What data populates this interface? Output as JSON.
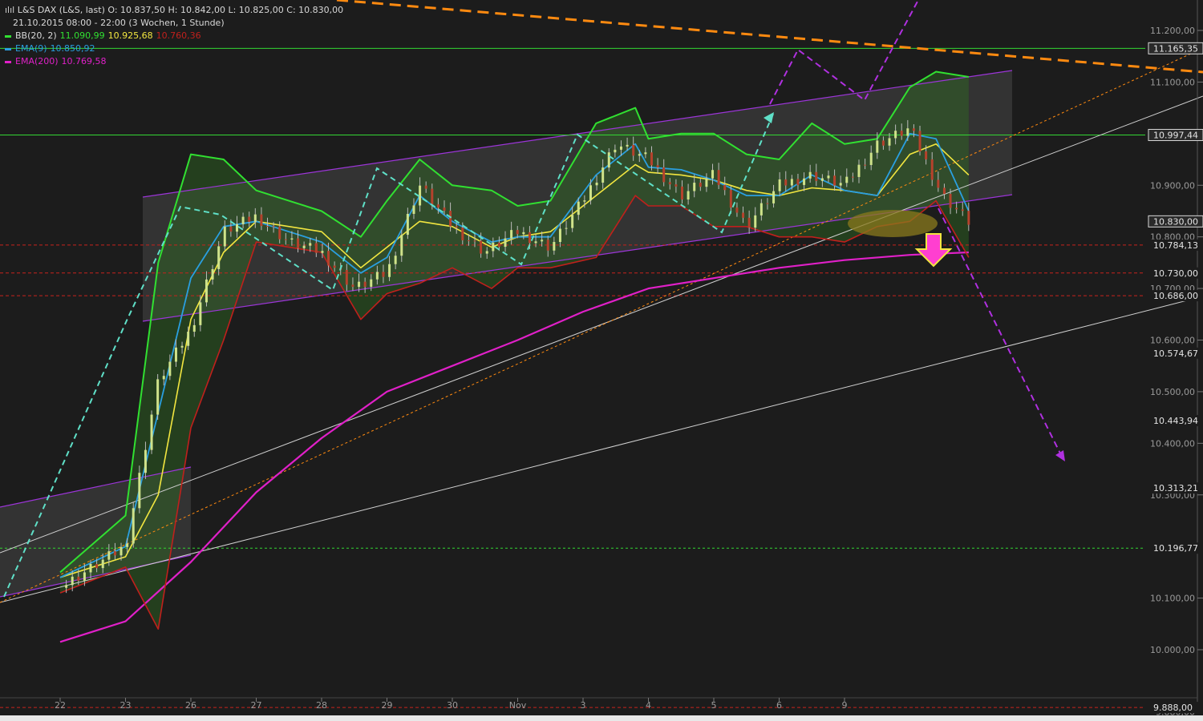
{
  "header": {
    "symbol_line": "L&S DAX (L&S, last)",
    "ohlc": "O: 10.837,50  H: 10.842,00  L: 10.825,00  C: 10.830,00",
    "range_line": "21.10.2015 08:00 - 22:00 (3 Wochen, 1 Stunde)"
  },
  "indicators": [
    {
      "label": "BB(20, 2)",
      "values": [
        "11.090,99",
        "10.925,68",
        "10.760,36"
      ],
      "colors": [
        "#31e031",
        "#f2e640",
        "#c0201c"
      ]
    },
    {
      "label": "EMA(9)",
      "values": [
        "10.850,92"
      ],
      "colors": [
        "#2a9fe0"
      ]
    },
    {
      "label": "EMA(200)",
      "values": [
        "10.769,58"
      ],
      "colors": [
        "#e020c8"
      ]
    }
  ],
  "colors": {
    "background": "#1c1c1c",
    "bb_upper": "#31e031",
    "bb_middle": "#f2e640",
    "bb_lower": "#c0201c",
    "ema9": "#2a9fe0",
    "ema200": "#e020c8",
    "channel": "#9c35d8",
    "resistance_orange": "#ff8a10",
    "arrow_down": "#ff3fd0"
  },
  "chart_data": {
    "type": "line",
    "title": "L&S DAX (L&S, last)",
    "xlabel": "",
    "ylabel": "",
    "ylim": [
      9888,
      11250
    ],
    "grid": false,
    "legend_position": "top-left",
    "y_ticks": [
      "11.200,00",
      "11.100,00",
      "10.997,00",
      "10.900,00",
      "10.800,00",
      "10.700,00",
      "10.600,00",
      "10.500,00",
      "10.400,00",
      "10.300,00",
      "10.100,00",
      "10.000,00",
      "9.880,00"
    ],
    "y_tick_values": [
      11200,
      11100,
      10997,
      10900,
      10800,
      10700,
      10600,
      10500,
      10400,
      10300,
      10100,
      10000,
      9880
    ],
    "x_ticks": [
      "22",
      "23",
      "26",
      "27",
      "28",
      "29",
      "30",
      "Nov",
      "3",
      "4",
      "5",
      "6",
      "9"
    ],
    "price_tags": [
      {
        "label": "11.165,35",
        "value": 11165.35,
        "line": "solid-green"
      },
      {
        "label": "10.997,44",
        "value": 10997.44,
        "line": "solid-green"
      },
      {
        "label": "10.830,00",
        "value": 10830.0,
        "line": "none"
      },
      {
        "label": "10.784,13",
        "value": 10784.13,
        "line": "dashed-red"
      },
      {
        "label": "10.730,00",
        "value": 10730.0,
        "line": "dashed-red"
      },
      {
        "label": "10.686,00",
        "value": 10686.0,
        "line": "dashed-red"
      },
      {
        "label": "10.574,67",
        "value": 10574.67,
        "line": "none"
      },
      {
        "label": "10.443,94",
        "value": 10443.94,
        "line": "none"
      },
      {
        "label": "10.313,21",
        "value": 10313.21,
        "line": "none"
      },
      {
        "label": "10.196,77",
        "value": 10196.77,
        "line": "dashed-green"
      },
      {
        "label": "9.888,00",
        "value": 9888.0,
        "line": "dashed-red"
      }
    ],
    "series": [
      {
        "name": "L&S DAX",
        "x": [
          0,
          1,
          1.5,
          2,
          2.5,
          3,
          3.5,
          4,
          4.5,
          5,
          5.5,
          6,
          6.5,
          7,
          7.5,
          8,
          8.5,
          9,
          9.5,
          10,
          10.5,
          11,
          11.5,
          12,
          12.5,
          13,
          13.5,
          13.9
        ],
        "values": [
          10120,
          10200,
          10520,
          10620,
          10810,
          10840,
          10790,
          10770,
          10700,
          10730,
          10900,
          10820,
          10770,
          10810,
          10780,
          10870,
          10980,
          10950,
          10880,
          10920,
          10820,
          10900,
          10920,
          10900,
          10980,
          11010,
          10880,
          10830
        ]
      },
      {
        "name": "BB(20, 2)",
        "x": [
          0,
          1,
          1.5,
          2,
          2.5,
          3,
          4,
          4.6,
          5,
          5.5,
          6,
          6.6,
          7,
          7.5,
          8.2,
          8.8,
          9,
          9.5,
          10,
          10.5,
          11,
          11.5,
          12,
          12.5,
          13,
          13.4,
          13.9
        ],
        "values": [
          10150,
          10260,
          10750,
          10960,
          10950,
          10890,
          10850,
          10800,
          10870,
          10950,
          10900,
          10890,
          10860,
          10870,
          11020,
          11050,
          10990,
          11000,
          11000,
          10960,
          10950,
          11020,
          10980,
          10990,
          11090,
          11120,
          11110
        ]
      },
      {
        "name": "BB(20, 2) middle",
        "x": [
          0,
          1,
          1.5,
          2,
          2.5,
          3,
          4,
          4.6,
          5,
          5.5,
          6,
          6.6,
          7,
          7.5,
          8.2,
          8.8,
          9,
          9.5,
          10,
          10.5,
          11,
          11.5,
          12,
          12.5,
          13,
          13.4,
          13.9
        ],
        "values": [
          10140,
          10180,
          10300,
          10640,
          10770,
          10830,
          10810,
          10740,
          10780,
          10830,
          10820,
          10780,
          10800,
          10810,
          10880,
          10940,
          10925,
          10920,
          10910,
          10890,
          10880,
          10895,
          10890,
          10880,
          10960,
          10980,
          10920
        ]
      },
      {
        "name": "BB(20, 2) lower",
        "x": [
          0,
          1,
          1.5,
          2,
          2.5,
          3,
          4,
          4.6,
          5,
          5.5,
          6,
          6.6,
          7,
          7.5,
          8.2,
          8.8,
          9,
          9.5,
          10,
          10.5,
          11,
          11.5,
          12,
          12.5,
          13,
          13.4,
          13.9
        ],
        "values": [
          10110,
          10160,
          10040,
          10430,
          10600,
          10790,
          10770,
          10640,
          10690,
          10710,
          10740,
          10700,
          10740,
          10740,
          10760,
          10880,
          10860,
          10860,
          10820,
          10820,
          10800,
          10800,
          10790,
          10820,
          10830,
          10870,
          10760
        ]
      },
      {
        "name": "EMA(9)",
        "x": [
          0,
          1,
          1.5,
          2,
          2.5,
          3,
          4,
          4.6,
          5,
          5.5,
          6,
          6.6,
          7,
          7.5,
          8.2,
          8.8,
          9,
          9.5,
          10,
          10.5,
          11,
          11.5,
          12,
          12.5,
          13,
          13.4,
          13.9
        ],
        "values": [
          10140,
          10200,
          10460,
          10720,
          10820,
          10830,
          10790,
          10730,
          10760,
          10880,
          10830,
          10790,
          10800,
          10800,
          10920,
          10980,
          10935,
          10930,
          10910,
          10880,
          10880,
          10920,
          10890,
          10880,
          11000,
          10990,
          10850
        ]
      },
      {
        "name": "EMA(200)",
        "x": [
          0,
          1,
          2,
          3,
          4,
          5,
          6,
          7,
          8,
          9,
          10,
          11,
          12,
          13,
          13.9
        ],
        "values": [
          10015,
          10055,
          10170,
          10305,
          10410,
          10500,
          10550,
          10600,
          10655,
          10700,
          10720,
          10740,
          10755,
          10765,
          10770
        ]
      }
    ]
  }
}
